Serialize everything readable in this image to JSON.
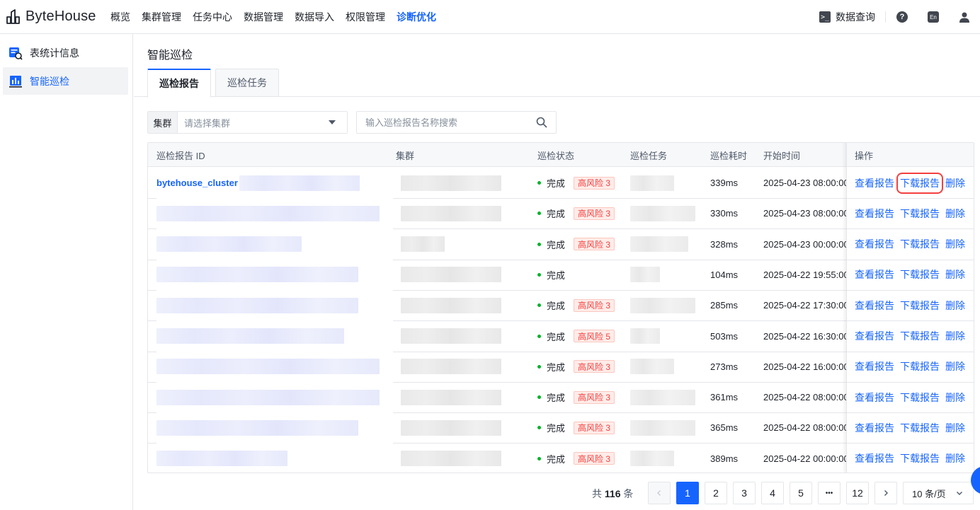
{
  "app": {
    "name": "ByteHouse"
  },
  "nav": {
    "items": [
      "概览",
      "集群管理",
      "任务中心",
      "数据管理",
      "数据导入",
      "权限管理",
      "诊断优化"
    ],
    "active_index": 6
  },
  "top_right": {
    "query_label": "数据查询",
    "lang": "En"
  },
  "sidebar": {
    "items": [
      {
        "label": "表统计信息",
        "icon": "table-stats-icon"
      },
      {
        "label": "智能巡检",
        "icon": "bar-chart-icon"
      }
    ],
    "active_index": 1
  },
  "page": {
    "title": "智能巡检"
  },
  "tabs": [
    {
      "label": "巡检报告"
    },
    {
      "label": "巡检任务"
    }
  ],
  "filter": {
    "label": "集群",
    "placeholder": "请选择集群"
  },
  "search": {
    "placeholder": "输入巡检报告名称搜索"
  },
  "table": {
    "headers": [
      "巡检报告 ID",
      "集群",
      "巡检状态",
      "巡检任务",
      "巡检耗时",
      "开始时间",
      "操作"
    ],
    "rows": [
      {
        "id": "bytehouse_cluster",
        "status": "完成",
        "risk": "高风险 3",
        "duration": "339ms",
        "start": "2025-04-23 08:00:00"
      },
      {
        "id": "",
        "status": "完成",
        "risk": "高风险 3",
        "duration": "330ms",
        "start": "2025-04-23 08:00:00"
      },
      {
        "id": "",
        "status": "完成",
        "risk": "高风险 3",
        "duration": "328ms",
        "start": "2025-04-23 00:00:00"
      },
      {
        "id": "",
        "status": "完成",
        "risk": "",
        "duration": "104ms",
        "start": "2025-04-22 19:55:00"
      },
      {
        "id": "",
        "status": "完成",
        "risk": "高风险 3",
        "duration": "285ms",
        "start": "2025-04-22 17:30:00"
      },
      {
        "id": "",
        "status": "完成",
        "risk": "高风险 5",
        "duration": "503ms",
        "start": "2025-04-22 16:30:00"
      },
      {
        "id": "",
        "status": "完成",
        "risk": "高风险 3",
        "duration": "273ms",
        "start": "2025-04-22 16:00:00"
      },
      {
        "id": "",
        "status": "完成",
        "risk": "高风险 3",
        "duration": "361ms",
        "start": "2025-04-22 08:00:00"
      },
      {
        "id": "",
        "status": "完成",
        "risk": "高风险 3",
        "duration": "365ms",
        "start": "2025-04-22 08:00:00"
      },
      {
        "id": "",
        "status": "完成",
        "risk": "高风险 3",
        "duration": "389ms",
        "start": "2025-04-22 00:00:00"
      }
    ],
    "actions": {
      "view": "查看报告",
      "download": "下载报告",
      "delete": "删除"
    }
  },
  "pagination": {
    "total_prefix": "共",
    "total": "116",
    "total_suffix": "条",
    "pages": [
      "1",
      "2",
      "3",
      "4",
      "5",
      "•••",
      "12"
    ],
    "current": "1",
    "page_size": "10 条/页"
  },
  "colors": {
    "accent": "#1664ff",
    "danger": "#f53f3f",
    "success": "#00b42a"
  }
}
